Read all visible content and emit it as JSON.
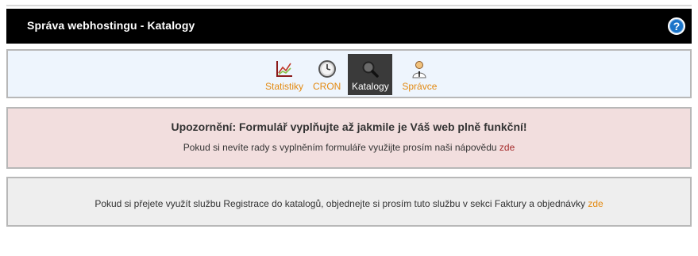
{
  "header": {
    "title": "Správa webhostingu - Katalogy",
    "help_icon": "help-icon",
    "help_symbol": "?"
  },
  "nav": {
    "items": [
      {
        "label": "Statistiky",
        "icon": "chart-icon",
        "active": false
      },
      {
        "label": "CRON",
        "icon": "clock-icon",
        "active": false
      },
      {
        "label": "Katalogy",
        "icon": "magnifier-icon",
        "active": true
      },
      {
        "label": "Správce",
        "icon": "admin-person-icon",
        "active": false
      }
    ]
  },
  "warning": {
    "heading": "Upozornění: Formulář vyplňujte až jakmile je Váš web plně funkční!",
    "text": "Pokud si nevíte rady s vyplněním formuláře využijte prosím naši nápovědu",
    "link": "zde"
  },
  "info": {
    "text": "Pokud si přejete využít službu Registrace do katalogů, objednejte si prosím tuto službu v sekci Faktury a objednávky",
    "link": "zde"
  },
  "colors": {
    "header_bg": "#000000",
    "nav_bg": "#eef5fd",
    "warning_bg": "#f2dede",
    "info_bg": "#eeeeee",
    "accent_orange": "#e38a12",
    "warning_link": "#a52a2a"
  }
}
